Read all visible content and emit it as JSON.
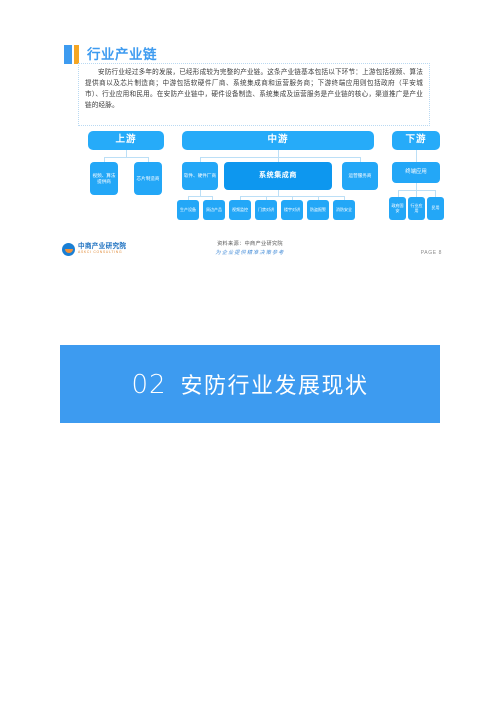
{
  "slide": {
    "section_title": "行业产业链",
    "body_paragraph": "安防行业经过多年的发展，已经形成较为完整的产业链。这条产业链基本包括以下环节：上游包括视频、算法提供商以及芯片制造商；中游包括软硬件厂商、系统集成商和运营服务商；下游终端应用则包括政府（平安城市）、行业应用和民用。在安防产业链中，硬件设备制造、系统集成及运营服务是产业链的核心，渠道推广是产业链的经脉。"
  },
  "diagram": {
    "headers": {
      "upstream": "上游",
      "midstream": "中游",
      "downstream": "下游"
    },
    "upstream_nodes": [
      {
        "label": "视频、算法提供商"
      },
      {
        "label": "芯片制造商"
      }
    ],
    "midstream_nodes": [
      {
        "label": "软件、硬件厂商"
      },
      {
        "label": "系统集成商"
      },
      {
        "label": "运营服务商"
      }
    ],
    "midstream_sub_left": [
      {
        "label": "生产设备"
      },
      {
        "label": "周边产品"
      }
    ],
    "midstream_sub_right": [
      {
        "label": "视频监控"
      },
      {
        "label": "门禁对讲"
      },
      {
        "label": "楼宇对讲"
      },
      {
        "label": "防盗报警"
      },
      {
        "label": "消防安全"
      }
    ],
    "downstream_nodes": [
      {
        "label": "终端应用"
      }
    ],
    "downstream_sub": [
      {
        "label": "政府国安"
      },
      {
        "label": "行业应用"
      },
      {
        "label": "民用"
      }
    ]
  },
  "footer": {
    "logo_cn": "中商产业研究院",
    "logo_en": "ASKCI CONSULTING",
    "source": "资料来源：中商产业研究院",
    "slogan": "为企业提供精准决策参考",
    "page": "PAGE 8"
  },
  "section_banner": {
    "number": "02",
    "title": "安防行业发展现状"
  },
  "colors": {
    "brand_blue": "#3d9bf0",
    "node_blue": "#23a7f7",
    "node_blue_dark": "#0d97ef",
    "accent_orange": "#f5a623",
    "connector": "#bcdff6"
  }
}
